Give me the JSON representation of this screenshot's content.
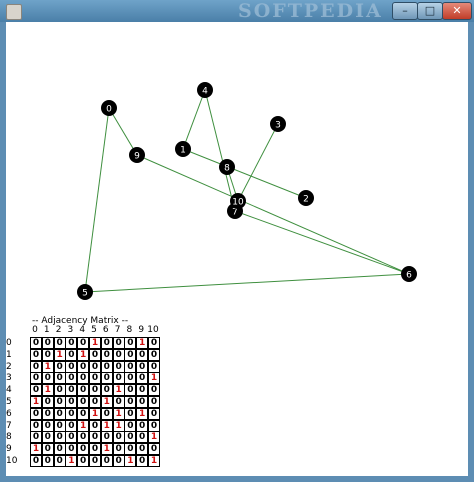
{
  "window": {
    "watermark": "SOFTPEDIA",
    "min_label": "–",
    "max_label": "□",
    "close_label": "✕"
  },
  "graph": {
    "node_color": "#000000",
    "label_color": "#ffffff",
    "edge_color": "#3f8f3f",
    "nodes": [
      {
        "id": "0"
      },
      {
        "id": "1"
      },
      {
        "id": "2"
      },
      {
        "id": "3"
      },
      {
        "id": "4"
      },
      {
        "id": "5"
      },
      {
        "id": "6"
      },
      {
        "id": "7"
      },
      {
        "id": "8"
      },
      {
        "id": "9"
      },
      {
        "id": "10"
      }
    ]
  },
  "matrix": {
    "title": "-- Adjacency Matrix --",
    "headers": [
      "0",
      "1",
      "2",
      "3",
      "4",
      "5",
      "6",
      "7",
      "8",
      "9",
      "10"
    ],
    "one_color": "#d01010",
    "rows": [
      [
        0,
        0,
        0,
        0,
        0,
        1,
        0,
        0,
        0,
        1,
        0
      ],
      [
        0,
        0,
        1,
        0,
        1,
        0,
        0,
        0,
        0,
        0,
        0
      ],
      [
        0,
        1,
        0,
        0,
        0,
        0,
        0,
        0,
        0,
        0,
        0
      ],
      [
        0,
        0,
        0,
        0,
        0,
        0,
        0,
        0,
        0,
        0,
        1
      ],
      [
        0,
        1,
        0,
        0,
        0,
        0,
        0,
        1,
        0,
        0,
        0
      ],
      [
        1,
        0,
        0,
        0,
        0,
        0,
        1,
        0,
        0,
        0,
        0
      ],
      [
        0,
        0,
        0,
        0,
        0,
        1,
        0,
        1,
        0,
        1,
        0
      ],
      [
        0,
        0,
        0,
        0,
        1,
        0,
        1,
        1,
        0,
        0,
        0
      ],
      [
        0,
        0,
        0,
        0,
        0,
        0,
        0,
        0,
        0,
        0,
        1
      ],
      [
        1,
        0,
        0,
        0,
        0,
        0,
        1,
        0,
        0,
        0,
        0
      ],
      [
        0,
        0,
        0,
        1,
        0,
        0,
        0,
        0,
        1,
        0,
        1
      ]
    ]
  }
}
